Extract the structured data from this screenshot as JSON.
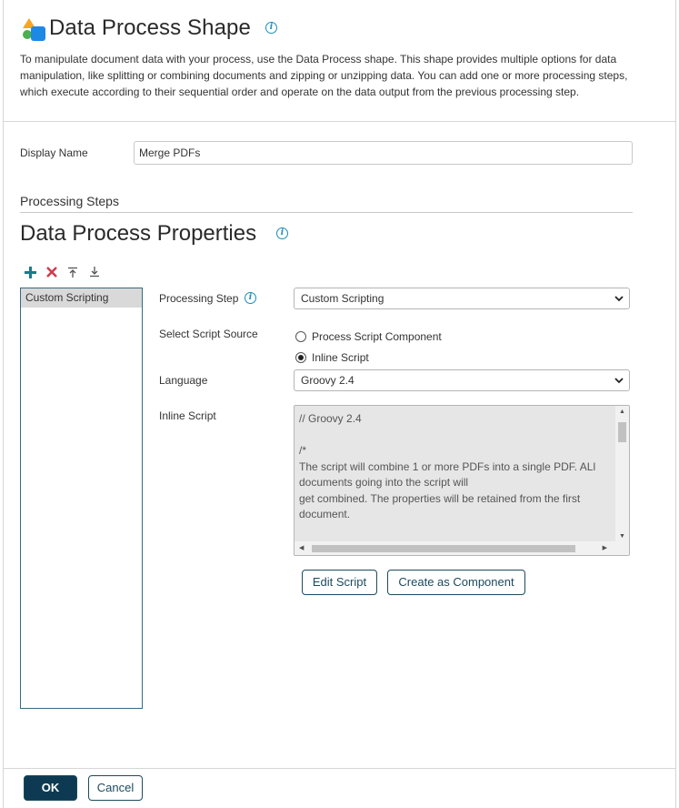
{
  "header": {
    "title": "Data Process Shape",
    "description": "To manipulate document data with your process, use the Data Process shape. This shape provides multiple options for data manipulation, like splitting or combining documents and zipping or unzipping data. You can add one or more processing steps, which execute according to their sequential order and operate on the data output from the previous processing step."
  },
  "form": {
    "display_name_label": "Display Name",
    "display_name_value": "Merge PDFs",
    "processing_steps_header": "Processing Steps"
  },
  "properties": {
    "title": "Data Process Properties",
    "toolbar": {
      "add": "add-icon",
      "remove": "remove-icon",
      "move_up": "move-top-icon",
      "move_down": "move-bottom-icon"
    },
    "steps": [
      {
        "label": "Custom Scripting"
      }
    ],
    "processing_step_label": "Processing Step",
    "processing_step_value": "Custom Scripting",
    "script_source_label": "Select Script Source",
    "script_source_options": [
      {
        "label": "Process Script Component",
        "selected": false
      },
      {
        "label": "Inline Script",
        "selected": true
      }
    ],
    "language_label": "Language",
    "language_value": "Groovy 2.4",
    "inline_script_label": "Inline Script",
    "inline_script_text": "// Groovy 2.4\n\n/*\nThe script will combine 1 or more PDFs into a single PDF. ALl documents going into the script will\nget combined. The properties will be retained from the first document.",
    "edit_script_label": "Edit Script",
    "create_component_label": "Create as Component"
  },
  "footer": {
    "ok_label": "OK",
    "cancel_label": "Cancel"
  },
  "colors": {
    "accent_teal": "#1a7a8a",
    "remove_red": "#d13a4a",
    "primary_button": "#0d3a52",
    "info_blue": "#1a8db8"
  }
}
